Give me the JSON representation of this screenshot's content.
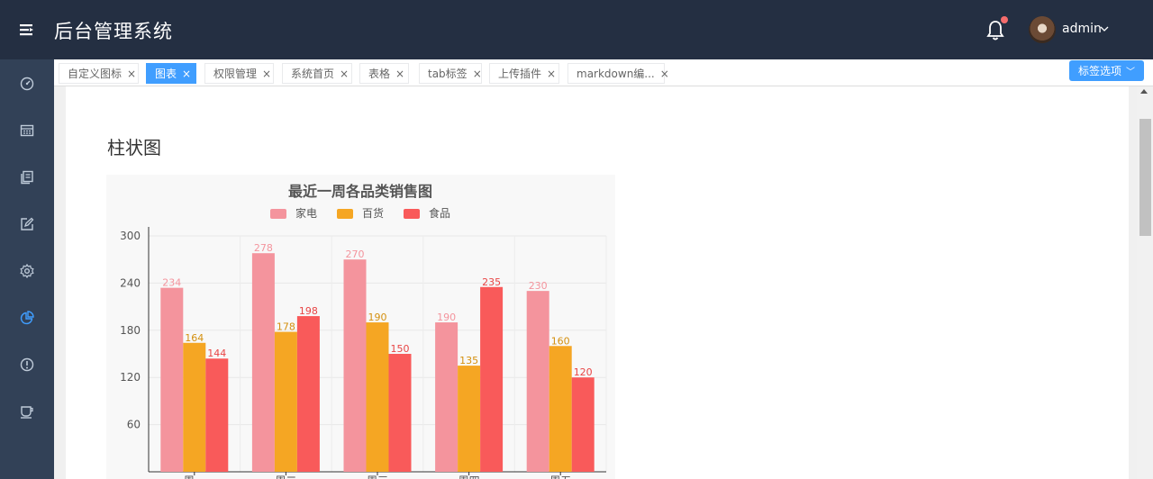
{
  "app": {
    "title": "后台管理系统"
  },
  "header": {
    "username": "admin",
    "has_notification": true
  },
  "sidebar": {
    "items": [
      {
        "icon": "dashboard-icon"
      },
      {
        "icon": "table-icon"
      },
      {
        "icon": "tabs-icon"
      },
      {
        "icon": "edit-icon"
      },
      {
        "icon": "settings-icon"
      },
      {
        "icon": "pie-chart-icon",
        "active": true
      },
      {
        "icon": "warning-icon"
      },
      {
        "icon": "coffee-icon"
      }
    ]
  },
  "tabs": [
    {
      "label": "自定义图标",
      "close": "×"
    },
    {
      "label": "图表",
      "close": "×",
      "active": true
    },
    {
      "label": "权限管理",
      "close": "×"
    },
    {
      "label": "系统首页",
      "close": "×"
    },
    {
      "label": "表格",
      "close": "×"
    },
    {
      "label": "tab标签",
      "close": "×"
    },
    {
      "label": "上传插件",
      "close": "×"
    },
    {
      "label": "markdown编...",
      "close": "×"
    }
  ],
  "tab_options_label": "标签选项",
  "main": {
    "section_title": "柱状图"
  },
  "colors": {
    "header_bg": "#242f42",
    "sidebar_bg": "#324157",
    "accent": "#409eff",
    "series_1": "#f4949d",
    "series_2": "#f5a623",
    "series_3": "#f95a5a"
  },
  "chart_data": {
    "type": "bar",
    "title": "最近一周各品类销售图",
    "categories": [
      "周一",
      "周二",
      "周三",
      "周四",
      "周五"
    ],
    "series": [
      {
        "name": "家电",
        "values": [
          234,
          278,
          270,
          190,
          230
        ]
      },
      {
        "name": "百货",
        "values": [
          164,
          178,
          190,
          135,
          160
        ]
      },
      {
        "name": "食品",
        "values": [
          144,
          198,
          150,
          235,
          120
        ]
      }
    ],
    "yticks": [
      60,
      120,
      180,
      240,
      300
    ],
    "ylim": [
      0,
      300
    ],
    "legend_position": "top",
    "grid": true
  }
}
